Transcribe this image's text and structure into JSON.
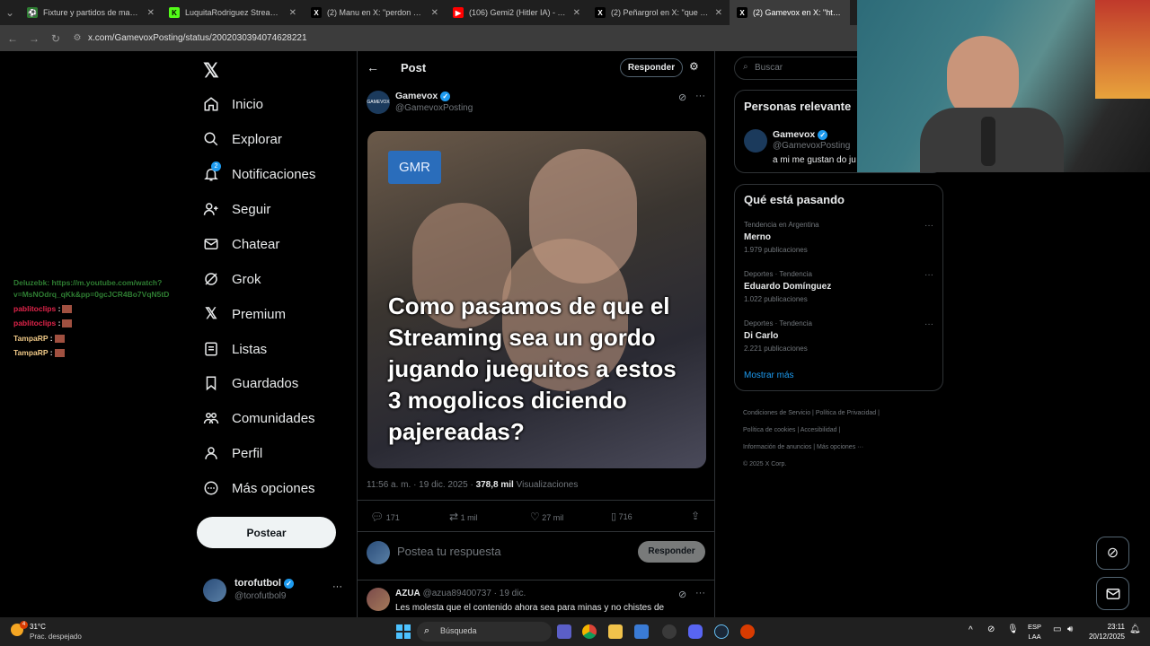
{
  "browser": {
    "tabs": [
      {
        "label": "Fixture y partidos de mañana e",
        "fav_color": "#2e7d32",
        "fav_glyph": "⚽"
      },
      {
        "label": "LuquitaRodriguez Stream - Wat",
        "fav_color": "#53fc18",
        "fav_glyph": "K"
      },
      {
        "label": "(2) Manu en X: \"perdon a todo",
        "fav_color": "#000000",
        "fav_glyph": "𝕏"
      },
      {
        "label": "(106) Gemi2 (Hitler IA) - YouTub",
        "fav_color": "#ff0000",
        "fav_glyph": "▶"
      },
      {
        "label": "(2) Peñargrol en X: \"que noche",
        "fav_color": "#000000",
        "fav_glyph": "𝕏"
      },
      {
        "label": "(2) Gamevox en X: \"https://t.co",
        "fav_color": "#000000",
        "fav_glyph": "𝕏"
      }
    ],
    "url": "x.com/GamevoxPosting/status/2002030394074628221"
  },
  "chat": [
    {
      "user": "Deluzebk",
      "text": ": https://m.youtube.com/watch?",
      "color": "#2e7d32"
    },
    {
      "user": "",
      "text": "v=MsNOdrq_qKk&pp=0gcJCR4Bo7VqN5tD",
      "color": "#2e7d32"
    },
    {
      "user": "pablitoclips",
      "text": ":",
      "color": "#e0244a"
    },
    {
      "user": "pablitoclips",
      "text": ":",
      "color": "#e0244a"
    },
    {
      "user": "TampaRP",
      "text": ":",
      "color": "#f0c987"
    },
    {
      "user": "TampaRP",
      "text": ":",
      "color": "#f0c987"
    }
  ],
  "sidebar": {
    "items": [
      {
        "label": "Inicio",
        "icon": "home-icon"
      },
      {
        "label": "Explorar",
        "icon": "search-icon"
      },
      {
        "label": "Notificaciones",
        "icon": "bell-icon",
        "badge": "2"
      },
      {
        "label": "Seguir",
        "icon": "follow-icon"
      },
      {
        "label": "Chatear",
        "icon": "mail-icon"
      },
      {
        "label": "Grok",
        "icon": "grok-icon"
      },
      {
        "label": "Premium",
        "icon": "x-icon"
      },
      {
        "label": "Listas",
        "icon": "list-icon"
      },
      {
        "label": "Guardados",
        "icon": "bookmark-icon"
      },
      {
        "label": "Comunidades",
        "icon": "communities-icon"
      },
      {
        "label": "Perfil",
        "icon": "profile-icon"
      },
      {
        "label": "Más opciones",
        "icon": "more-icon"
      }
    ],
    "post_button": "Postear",
    "account": {
      "name": "torofutbol",
      "handle": "@torofutbol9"
    }
  },
  "post_header": {
    "title": "Post",
    "reply_button": "Responder"
  },
  "post": {
    "author": "Gamevox",
    "handle": "@GamevoxPosting",
    "image_badge": "GMR",
    "image_text": "Como pasamos de que el Streaming sea un gordo jugando jueguitos a estos 3 mogolicos diciendo pajereadas?",
    "timestamp": "11:56 a. m. · 19 dic. 2025 ·",
    "views_count": "378,8 mil",
    "views_label": "Visualizaciones",
    "replies": "171",
    "reposts": "1 mil",
    "likes": "27 mil",
    "bookmarks": "716"
  },
  "reply_box": {
    "placeholder": "Postea tu respuesta",
    "button": "Responder"
  },
  "comment": {
    "author": "AZUA",
    "handle": "@azua89400737 · 19 dic.",
    "text": "Les molesta que el contenido ahora sea para minas y no chistes de"
  },
  "search": {
    "placeholder": "Buscar"
  },
  "relevant": {
    "title": "Personas relevante",
    "name": "Gamevox",
    "handle": "@GamevoxPosting",
    "bio": "a mi me gustan do ju"
  },
  "trends": {
    "title": "Qué está pasando",
    "items": [
      {
        "context": "Tendencia en Argentina",
        "name": "Merno",
        "count": "1.979 publicaciones"
      },
      {
        "context": "Deportes · Tendencia",
        "name": "Eduardo Domínguez",
        "count": "1.022 publicaciones"
      },
      {
        "context": "Deportes · Tendencia",
        "name": "Di Carlo",
        "count": "2.221 publicaciones"
      }
    ],
    "show_more": "Mostrar más"
  },
  "footer": {
    "links": [
      "Condiciones de Servicio",
      "Política de Privacidad",
      "Política de cookies",
      "Accesibilidad",
      "Información de anuncios",
      "Más opciones ···"
    ],
    "copyright": "© 2025 X Corp."
  },
  "taskbar": {
    "weather_temp": "31°C",
    "weather_desc": "Prac. despejado",
    "search_placeholder": "Búsqueda",
    "lang": "ESP",
    "lang2": "LAA",
    "time": "23:11",
    "date": "20/12/2025",
    "weather_badge": "4"
  },
  "colors": {
    "accent": "#1d9bf0",
    "bg": "#000000",
    "border": "#2f3336"
  }
}
